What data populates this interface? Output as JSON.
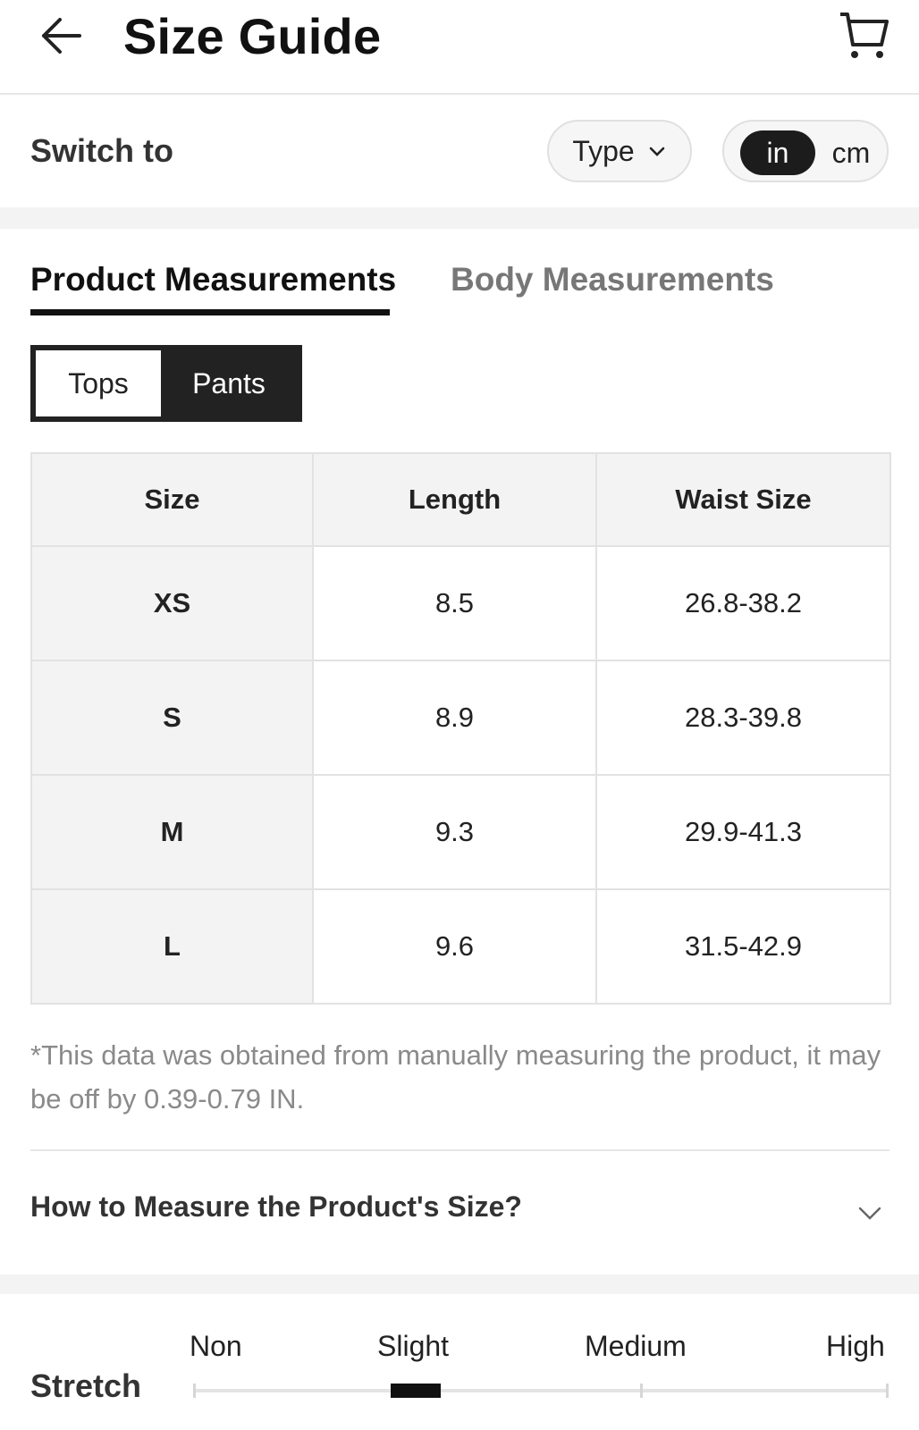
{
  "header": {
    "title": "Size Guide",
    "back_icon": "arrow-left-icon",
    "cart_icon": "cart-icon"
  },
  "switch": {
    "label": "Switch to",
    "type_dropdown": "Type",
    "units": [
      "in",
      "cm"
    ],
    "selected_unit": "in"
  },
  "tabs": {
    "product": "Product Measurements",
    "body": "Body Measurements",
    "active": "product"
  },
  "segment": {
    "tops": "Tops",
    "pants": "Pants",
    "selected": "Pants"
  },
  "table": {
    "headers": [
      "Size",
      "Length",
      "Waist Size"
    ],
    "rows": [
      [
        "XS",
        "8.5",
        "26.8-38.2"
      ],
      [
        "S",
        "8.9",
        "28.3-39.8"
      ],
      [
        "M",
        "9.3",
        "29.9-41.3"
      ],
      [
        "L",
        "9.6",
        "31.5-42.9"
      ]
    ]
  },
  "note": "*This data was obtained from manually measuring the product, it may be off by 0.39-0.79 IN.",
  "howto": {
    "label": "How to Measure the Product's Size?"
  },
  "stretch": {
    "label": "Stretch",
    "options": [
      "Non",
      "Slight",
      "Medium",
      "High"
    ],
    "selected": "Slight",
    "level_fraction": 0.32
  },
  "colors": {
    "accent": "#111111",
    "muted_text": "#8a8a8a",
    "band": "#f3f3f3"
  }
}
